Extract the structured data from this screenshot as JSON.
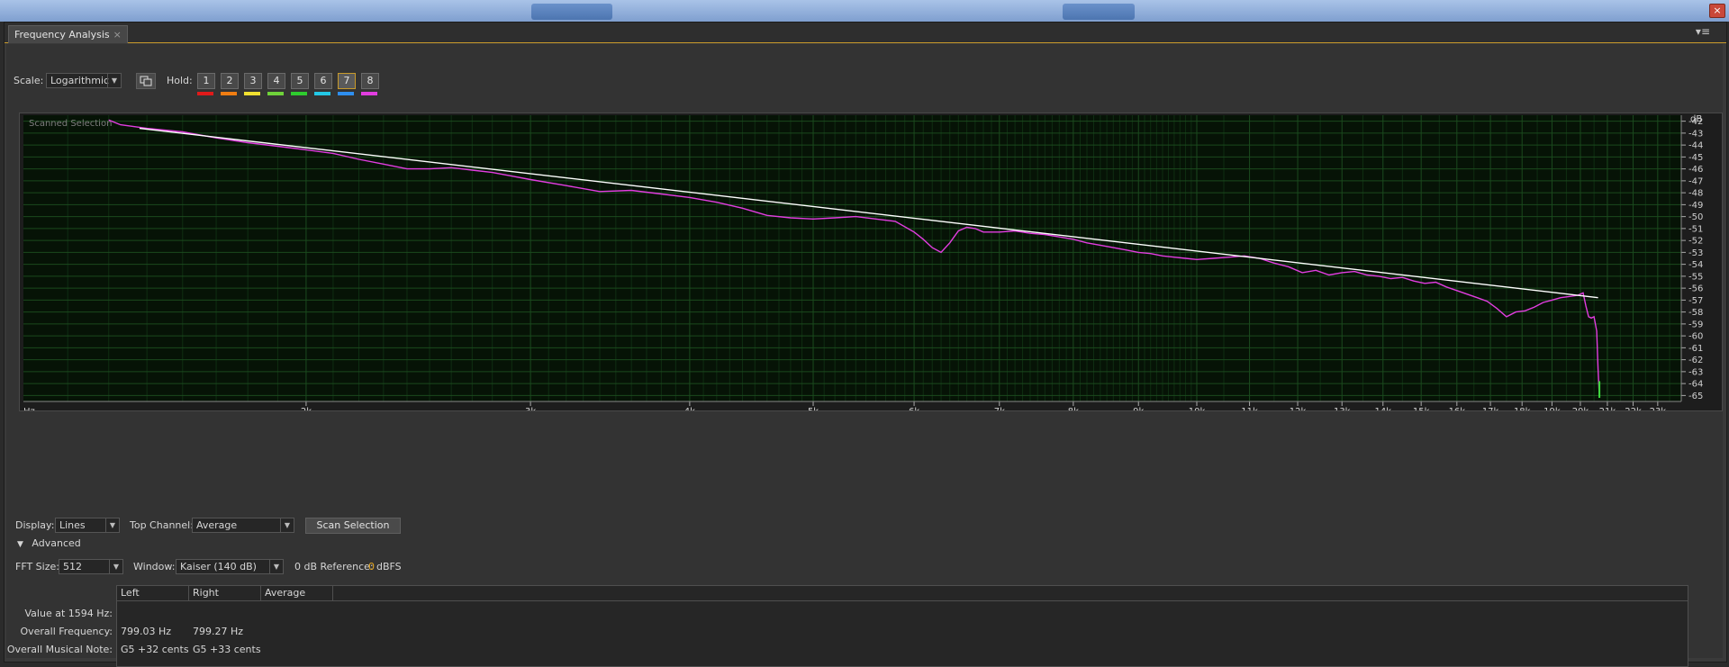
{
  "window": {
    "close_glyph": "×"
  },
  "tab": {
    "title": "Frequency Analysis",
    "close_glyph": "×"
  },
  "panel_menu_glyph": "▾≡",
  "toolbar": {
    "scale_label": "Scale:",
    "scale_value": "Logarithmic",
    "hold_label": "Hold:",
    "hold_buttons": [
      "1",
      "2",
      "3",
      "4",
      "5",
      "6",
      "7",
      "8"
    ],
    "hold_colors": [
      "#e01a1a",
      "#f07d12",
      "#f0e030",
      "#6fd23a",
      "#2ecc2e",
      "#23c8e6",
      "#2e8ff0",
      "#e23de0"
    ],
    "hold_active": "7"
  },
  "chart_data": {
    "type": "line",
    "overlay_label": "Scanned Selection",
    "x_axis_label": "Hz",
    "y_axis_label": "dB",
    "x_scale": "log",
    "x_ticks": [
      "2k",
      "3k",
      "4k",
      "5k",
      "6k",
      "7k",
      "8k",
      "9k",
      "10k",
      "11k",
      "12k",
      "13k",
      "14k",
      "15k",
      "16k",
      "17k",
      "18k",
      "19k",
      "20k",
      "21k",
      "22k",
      "23k"
    ],
    "y_ticks": [
      "-42",
      "-43",
      "-44",
      "-45",
      "-46",
      "-47",
      "-48",
      "-49",
      "-50",
      "-51",
      "-52",
      "-53",
      "-54",
      "-55",
      "-56",
      "-57",
      "-58",
      "-59",
      "-60",
      "-61",
      "-62",
      "-63",
      "-64",
      "-65"
    ],
    "xlim": [
      1200,
      24000
    ],
    "ylim": [
      -65.5,
      -41.5
    ],
    "grid": true,
    "series": [
      {
        "color": "#e23de0",
        "x": [
          1400,
          1430,
          1500,
          1600,
          1700,
          1800,
          1900,
          2000,
          2100,
          2200,
          2300,
          2400,
          2500,
          2600,
          2700,
          2800,
          2900,
          3000,
          3200,
          3400,
          3600,
          3800,
          4000,
          4200,
          4400,
          4600,
          4800,
          5000,
          5200,
          5400,
          5600,
          5800,
          6000,
          6100,
          6200,
          6300,
          6400,
          6500,
          6600,
          6700,
          6800,
          7000,
          7200,
          7400,
          7600,
          7800,
          8000,
          8200,
          8400,
          8600,
          8800,
          9000,
          9200,
          9400,
          9600,
          9800,
          10000,
          10300,
          10600,
          10900,
          11200,
          11500,
          11800,
          12100,
          12400,
          12700,
          13000,
          13300,
          13600,
          13900,
          14200,
          14500,
          14800,
          15100,
          15400,
          15700,
          16000,
          16300,
          16600,
          16900,
          17200,
          17500,
          17800,
          18100,
          18400,
          18700,
          19000,
          19300,
          19600,
          19900,
          20100,
          20200,
          20300,
          20400,
          20500,
          20600,
          20650,
          20700
        ],
        "y": [
          -41.9,
          -42.3,
          -42.6,
          -42.9,
          -43.4,
          -43.8,
          -44.1,
          -44.4,
          -44.7,
          -45.2,
          -45.6,
          -46.0,
          -46.0,
          -45.9,
          -46.1,
          -46.3,
          -46.6,
          -46.9,
          -47.4,
          -47.9,
          -47.8,
          -48.1,
          -48.4,
          -48.8,
          -49.3,
          -49.9,
          -50.1,
          -50.2,
          -50.1,
          -50.0,
          -50.2,
          -50.4,
          -51.3,
          -51.9,
          -52.6,
          -53.0,
          -52.2,
          -51.2,
          -50.9,
          -51.0,
          -51.3,
          -51.3,
          -51.2,
          -51.4,
          -51.5,
          -51.7,
          -51.9,
          -52.2,
          -52.4,
          -52.6,
          -52.8,
          -53.0,
          -53.1,
          -53.3,
          -53.4,
          -53.5,
          -53.6,
          -53.5,
          -53.4,
          -53.3,
          -53.5,
          -53.9,
          -54.2,
          -54.7,
          -54.5,
          -54.9,
          -54.7,
          -54.6,
          -54.9,
          -55.0,
          -55.2,
          -55.1,
          -55.4,
          -55.6,
          -55.5,
          -55.9,
          -56.2,
          -56.5,
          -56.8,
          -57.1,
          -57.7,
          -58.4,
          -58.0,
          -57.9,
          -57.6,
          -57.2,
          -57.0,
          -56.8,
          -56.7,
          -56.6,
          -56.4,
          -57.5,
          -58.4,
          -58.5,
          -58.4,
          -59.6,
          -62.8,
          -65.2
        ]
      },
      {
        "color": "#ffffff",
        "x": [
          1480,
          20650
        ],
        "y": [
          -42.6,
          -56.8
        ]
      }
    ]
  },
  "controls": {
    "display_label": "Display:",
    "display_value": "Lines",
    "top_channel_label": "Top Channel:",
    "top_channel_value": "Average",
    "scan_button": "Scan Selection",
    "advanced_label": "Advanced",
    "fft_label": "FFT Size:",
    "fft_value": "512",
    "window_label": "Window:",
    "window_value": "Kaiser (140 dB)",
    "ref_label": "0 dB Reference:",
    "ref_number": "0",
    "ref_unit": "dBFS"
  },
  "table": {
    "headers": [
      "Left",
      "Right",
      "Average"
    ],
    "rows": [
      {
        "label": "Value at 1594 Hz:",
        "left": "",
        "right": ""
      },
      {
        "label": "Overall Frequency:",
        "left": "799.03 Hz",
        "right": "799.27 Hz"
      },
      {
        "label": "Overall Musical Note:",
        "left": "G5 +32 cents",
        "right": "G5 +33 cents"
      }
    ]
  }
}
